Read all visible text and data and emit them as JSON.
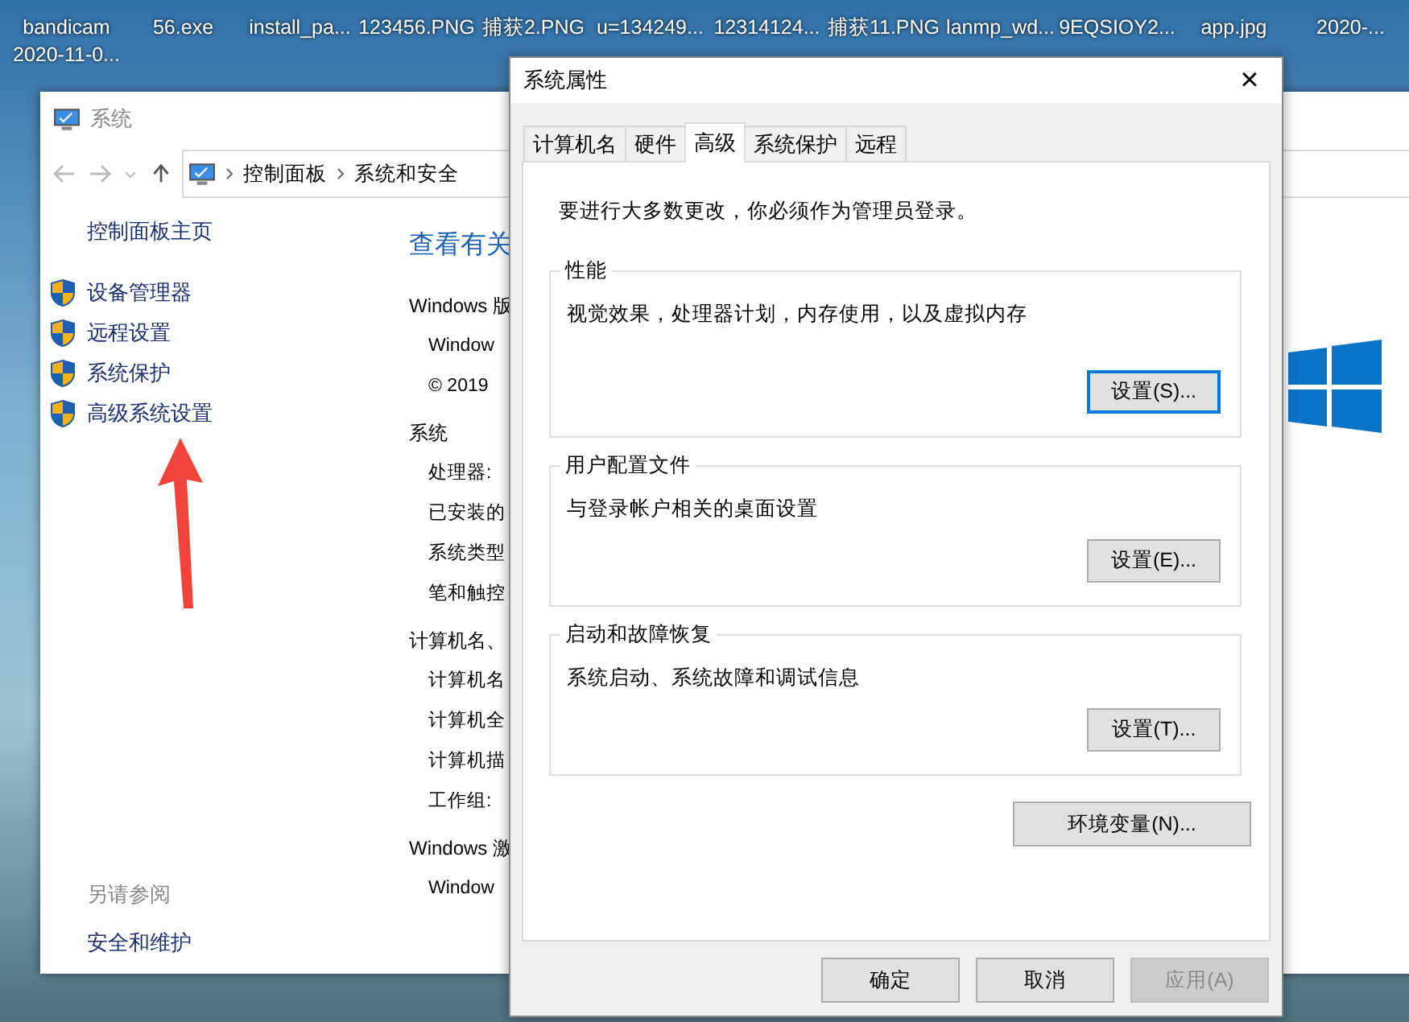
{
  "desktop_icons": [
    {
      "label": "bandicam 2020-11-0..."
    },
    {
      "label": "56.exe"
    },
    {
      "label": "install_pa..."
    },
    {
      "label": "123456.PNG"
    },
    {
      "label": "捕获2.PNG"
    },
    {
      "label": "u=134249..."
    },
    {
      "label": "12314124..."
    },
    {
      "label": "捕获11.PNG"
    },
    {
      "label": "lanmp_wd..."
    },
    {
      "label": "9EQSIOY2..."
    },
    {
      "label": "app.jpg"
    },
    {
      "label": "2020-..."
    }
  ],
  "system_window": {
    "title": "系统",
    "breadcrumb": [
      "控制面板",
      "系统和安全"
    ],
    "sidebar": {
      "home": "控制面板主页",
      "items": [
        {
          "label": "设备管理器"
        },
        {
          "label": "远程设置"
        },
        {
          "label": "系统保护"
        },
        {
          "label": "高级系统设置"
        }
      ],
      "see_also_heading": "另请参阅",
      "see_also": [
        "安全和维护"
      ]
    },
    "content": {
      "heading": "查看有关",
      "lines": [
        {
          "kind": "section",
          "text": "Windows 版"
        },
        {
          "kind": "item",
          "text": "Window"
        },
        {
          "kind": "item",
          "text": "© 2019"
        },
        {
          "kind": "section",
          "text": "系统"
        },
        {
          "kind": "item",
          "text": "处理器:"
        },
        {
          "kind": "item",
          "text": "已安装的"
        },
        {
          "kind": "item",
          "text": "系统类型"
        },
        {
          "kind": "item",
          "text": "笔和触控"
        },
        {
          "kind": "section",
          "text": "计算机名、"
        },
        {
          "kind": "item",
          "text": "计算机名"
        },
        {
          "kind": "item",
          "text": "计算机全"
        },
        {
          "kind": "item",
          "text": "计算机描"
        },
        {
          "kind": "item",
          "text": "工作组:"
        },
        {
          "kind": "section",
          "text": "Windows 激"
        },
        {
          "kind": "item",
          "text": "Window"
        }
      ]
    }
  },
  "dialog": {
    "title": "系统属性",
    "close": "×",
    "tabs": [
      {
        "label": "计算机名",
        "selected": false
      },
      {
        "label": "硬件",
        "selected": false
      },
      {
        "label": "高级",
        "selected": true
      },
      {
        "label": "系统保护",
        "selected": false
      },
      {
        "label": "远程",
        "selected": false
      }
    ],
    "note": "要进行大多数更改，你必须作为管理员登录。",
    "groups": [
      {
        "title": "性能",
        "description": "视觉效果，处理器计划，内存使用，以及虚拟内存",
        "button": "设置(S)...",
        "focused": true
      },
      {
        "title": "用户配置文件",
        "description": "与登录帐户相关的桌面设置",
        "button": "设置(E)...",
        "focused": false
      },
      {
        "title": "启动和故障恢复",
        "description": "系统启动、系统故障和调试信息",
        "button": "设置(T)...",
        "focused": false
      }
    ],
    "env_button": "环境变量(N)...",
    "buttons": [
      {
        "label": "确定",
        "disabled": false
      },
      {
        "label": "取消",
        "disabled": false
      },
      {
        "label": "应用(A)",
        "disabled": true
      }
    ]
  }
}
